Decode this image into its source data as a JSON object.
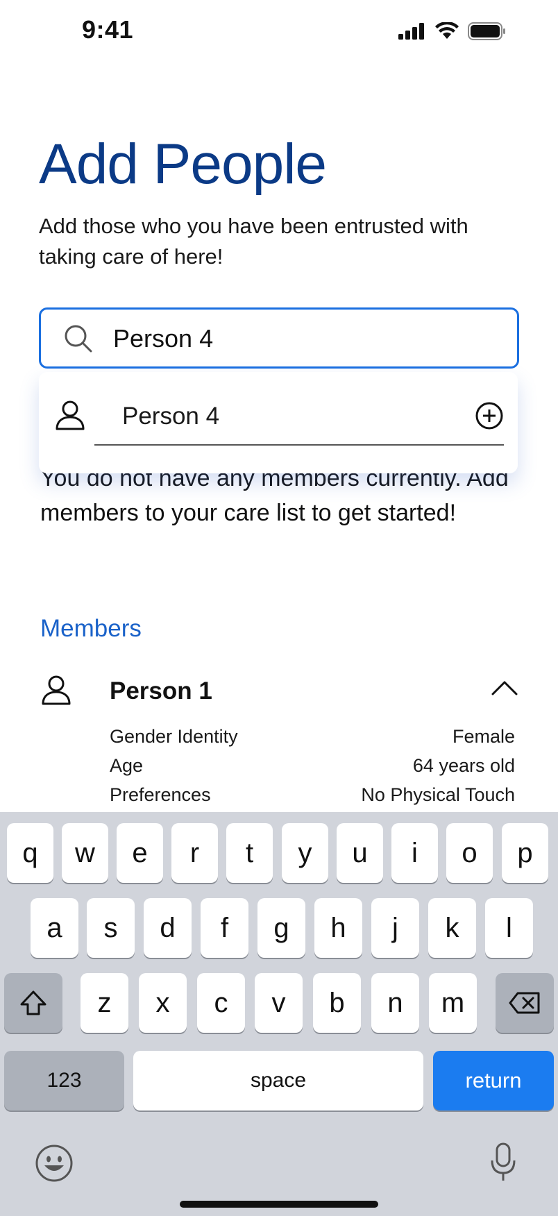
{
  "status_bar": {
    "time": "9:41"
  },
  "page": {
    "title": "Add People",
    "subtitle": "Add those who you have been entrusted with taking care of here!"
  },
  "search": {
    "value": "Person 4",
    "placeholder": ""
  },
  "dropdown": {
    "suggestion_name": "Person 4"
  },
  "empty_state": {
    "text": "You do not have any members currently. Add members to your care list to get started!"
  },
  "members": {
    "heading": "Members",
    "items": [
      {
        "name": "Person 1",
        "details": [
          {
            "label": "Gender Identity",
            "value": "Female"
          },
          {
            "label": "Age",
            "value": "64 years old"
          },
          {
            "label": "Preferences",
            "value": "No Physical Touch"
          }
        ]
      }
    ]
  },
  "keyboard": {
    "row1": [
      "q",
      "w",
      "e",
      "r",
      "t",
      "y",
      "u",
      "i",
      "o",
      "p"
    ],
    "row2": [
      "a",
      "s",
      "d",
      "f",
      "g",
      "h",
      "j",
      "k",
      "l"
    ],
    "row3": [
      "z",
      "x",
      "c",
      "v",
      "b",
      "n",
      "m"
    ],
    "numbers_label": "123",
    "space_label": "space",
    "return_label": "return"
  },
  "colors": {
    "title": "#0b3a86",
    "accent": "#1a6fe0",
    "members_heading": "#1a62c9",
    "return_key": "#1b7cf0"
  },
  "icons": {
    "search": "search-icon",
    "person": "person-icon",
    "add": "add-circle-icon",
    "chevron": "chevron-up-icon",
    "shift": "shift-icon",
    "backspace": "backspace-icon",
    "emoji": "emoji-icon",
    "mic": "microphone-icon"
  }
}
